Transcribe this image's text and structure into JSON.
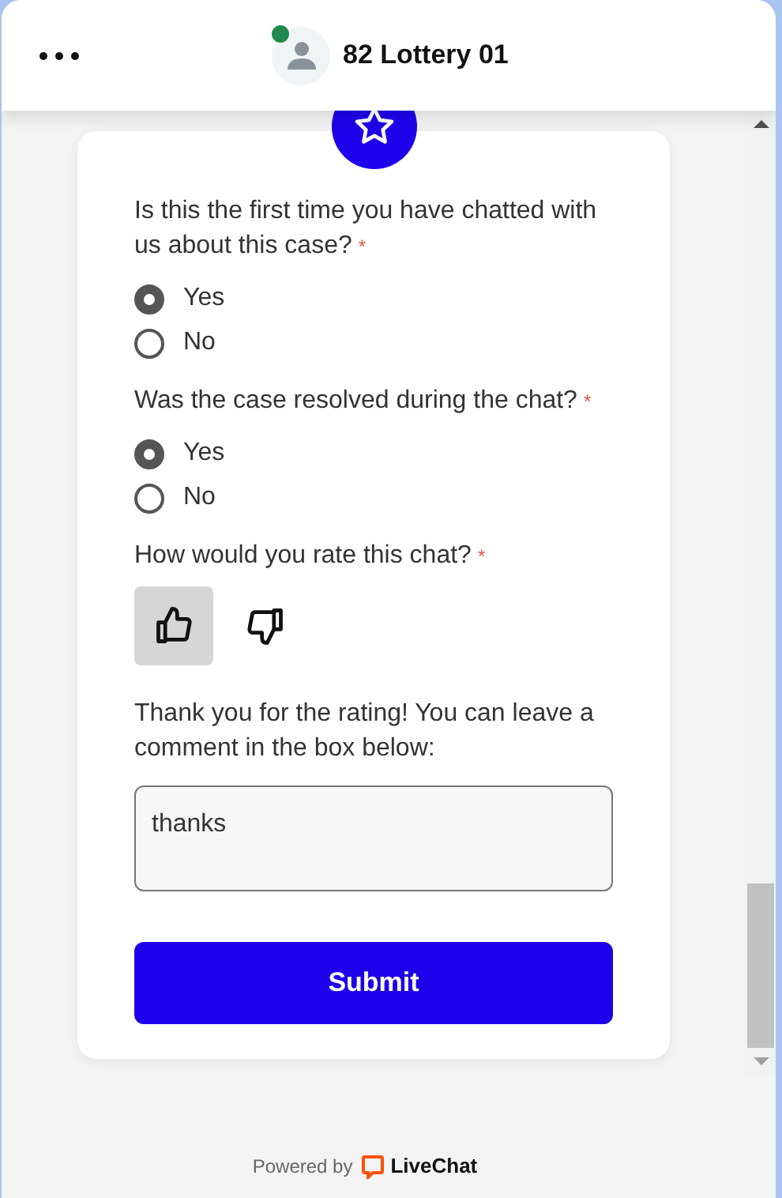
{
  "header": {
    "title": "82 Lottery 01",
    "online": true
  },
  "questions": [
    {
      "kind": "radio",
      "label": "Is this the first time you have chatted with us about this case?",
      "required_mark": "*",
      "options": [
        {
          "label": "Yes",
          "selected": true
        },
        {
          "label": "No",
          "selected": false
        }
      ]
    },
    {
      "kind": "radio",
      "label": "Was the case resolved during the chat?",
      "required_mark": "*",
      "options": [
        {
          "label": "Yes",
          "selected": true
        },
        {
          "label": "No",
          "selected": false
        }
      ]
    },
    {
      "kind": "rating",
      "label": "How would you rate this chat?",
      "required_mark": "*",
      "good_selected": true,
      "bad_selected": false
    },
    {
      "kind": "comment",
      "label": "Thank you for the rating! You can leave a comment in the box below:",
      "value": "thanks"
    }
  ],
  "submit": "Submit",
  "footer": {
    "prefix": "Powered by",
    "brand": "LiveChat"
  }
}
